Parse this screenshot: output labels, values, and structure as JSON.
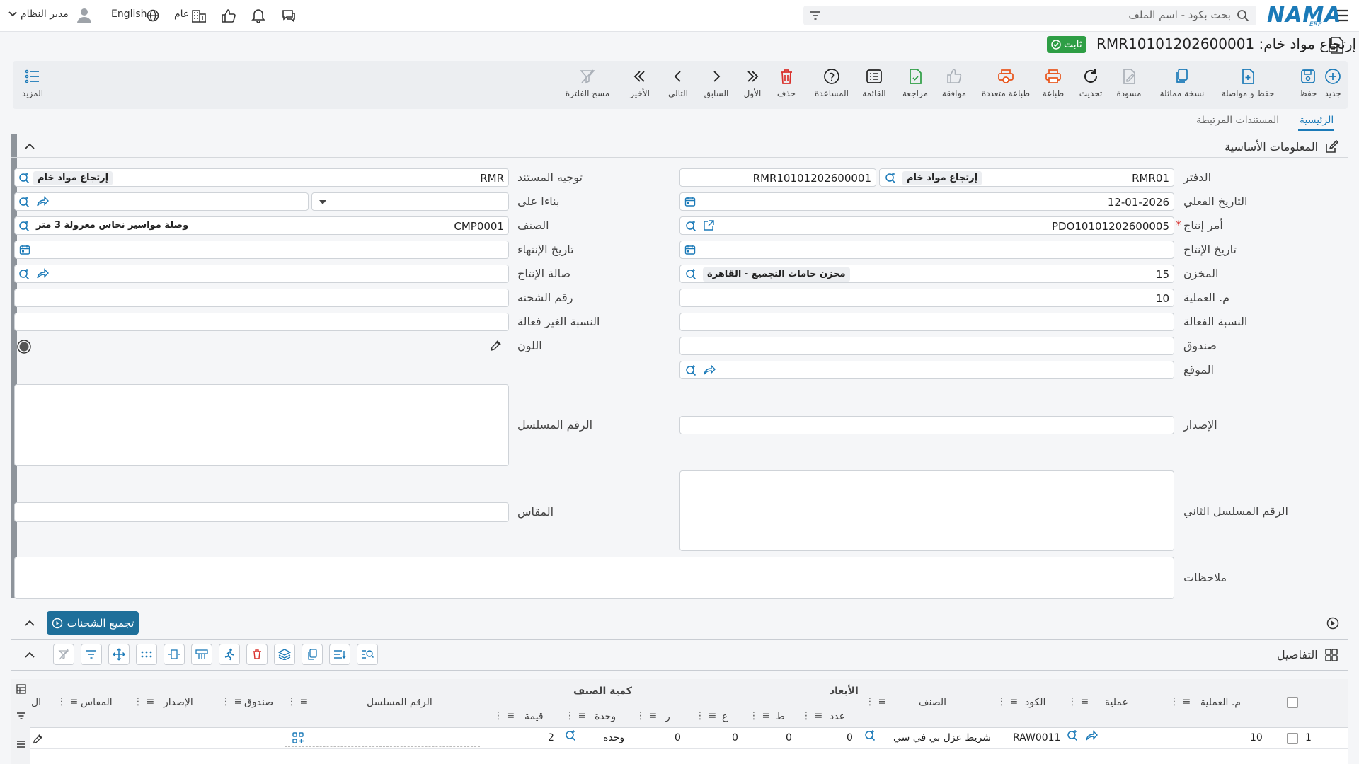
{
  "header": {
    "brand": "NAMA",
    "brand_sub": "ERP",
    "search_placeholder": "بحث بكود - اسم الملف",
    "language": "English",
    "general": "عام",
    "user_role": "مدير النظام"
  },
  "title": {
    "text": "إرتجاع مواد خام: RMR10101202600001",
    "status": "ثابت"
  },
  "toolbar": {
    "new": "جديد",
    "save": "حفظ",
    "save_continue": "حفظ و مواصلة",
    "duplicate": "نسخة مماثلة",
    "draft": "مسودة",
    "refresh": "تحديث",
    "print": "طباعة",
    "multi_print": "طباعة متعددة",
    "approve": "موافقة",
    "review": "مراجعة",
    "list": "القائمة",
    "help": "المساعدة",
    "delete": "حذف",
    "first": "الأول",
    "previous": "السابق",
    "next": "التالي",
    "last": "الأخير",
    "clear_filter": "مسح الفلترة",
    "more": "المزيد"
  },
  "tabs": {
    "main": "الرئيسية",
    "related": "المستندات المرتبطة"
  },
  "basic_info": {
    "section_title": "المعلومات الأساسية",
    "labels": {
      "book": "الدفتر",
      "actual_date": "التاريخ الفعلي",
      "production_order": "أمر إنتاج",
      "production_date": "تاريخ الإنتاج",
      "warehouse": "المخزن",
      "operation_no": "م. العملية",
      "effective_ratio": "النسبة الفعالة",
      "box": "صندوق",
      "location": "الموقع",
      "revision": "الإصدار",
      "second_serial": "الرقم المسلسل الثاني",
      "notes": "ملاحظات",
      "doc_direction": "توجيه المستند",
      "based_on": "بناءا على",
      "item": "الصنف",
      "end_date": "تاريخ الإنتهاء",
      "production_hall": "صالة الإنتاج",
      "lot_number": "رقم الشحنه",
      "ineffective_ratio": "النسبة الغير فعالة",
      "color": "اللون",
      "serial": "الرقم المسلسل",
      "size": "المقاس"
    },
    "values": {
      "book_code": "RMR01",
      "book_name": "إرتجاع مواد خام",
      "doc_code": "RMR10101202600001",
      "actual_date": "12-01-2026",
      "production_order": "PDO10101202600005",
      "warehouse_code": "15",
      "warehouse_name": "مخزن خامات التجميع - القاهرة",
      "operation_no": "10",
      "direction_code": "RMR",
      "direction_name": "إرتجاع مواد خام",
      "item_code": "CMP0001",
      "item_name": "وصلة مواسير نحاس معزولة 3 متر"
    }
  },
  "lots": {
    "button": "تجميع الشحنات"
  },
  "details": {
    "section_title": "التفاصيل",
    "group_dims": "الأبعاد",
    "group_qty": "كمية الصنف",
    "columns": {
      "op_no": "م. العملية",
      "operation": "عملية",
      "code": "الكود",
      "item": "الصنف",
      "count": "عدد",
      "l": "ط",
      "w": "ع",
      "h": "ر",
      "unit": "وحدة",
      "value": "قيمة",
      "serial": "الرقم المسلسل",
      "box": "صندوق",
      "revision": "الإصدار",
      "size": "المقاس",
      "cut": "ال"
    },
    "rows": [
      {
        "n": "1",
        "op_no": "10",
        "code": "RAW0011",
        "item": "شريط عزل بي في سي",
        "count": "0",
        "l": "0",
        "w": "0",
        "h": "0",
        "unit": "وحدة",
        "value": "2"
      }
    ]
  },
  "colors": {
    "accent": "#1b7ab8",
    "status_green": "#2e9e45",
    "required": "#d9302c"
  }
}
